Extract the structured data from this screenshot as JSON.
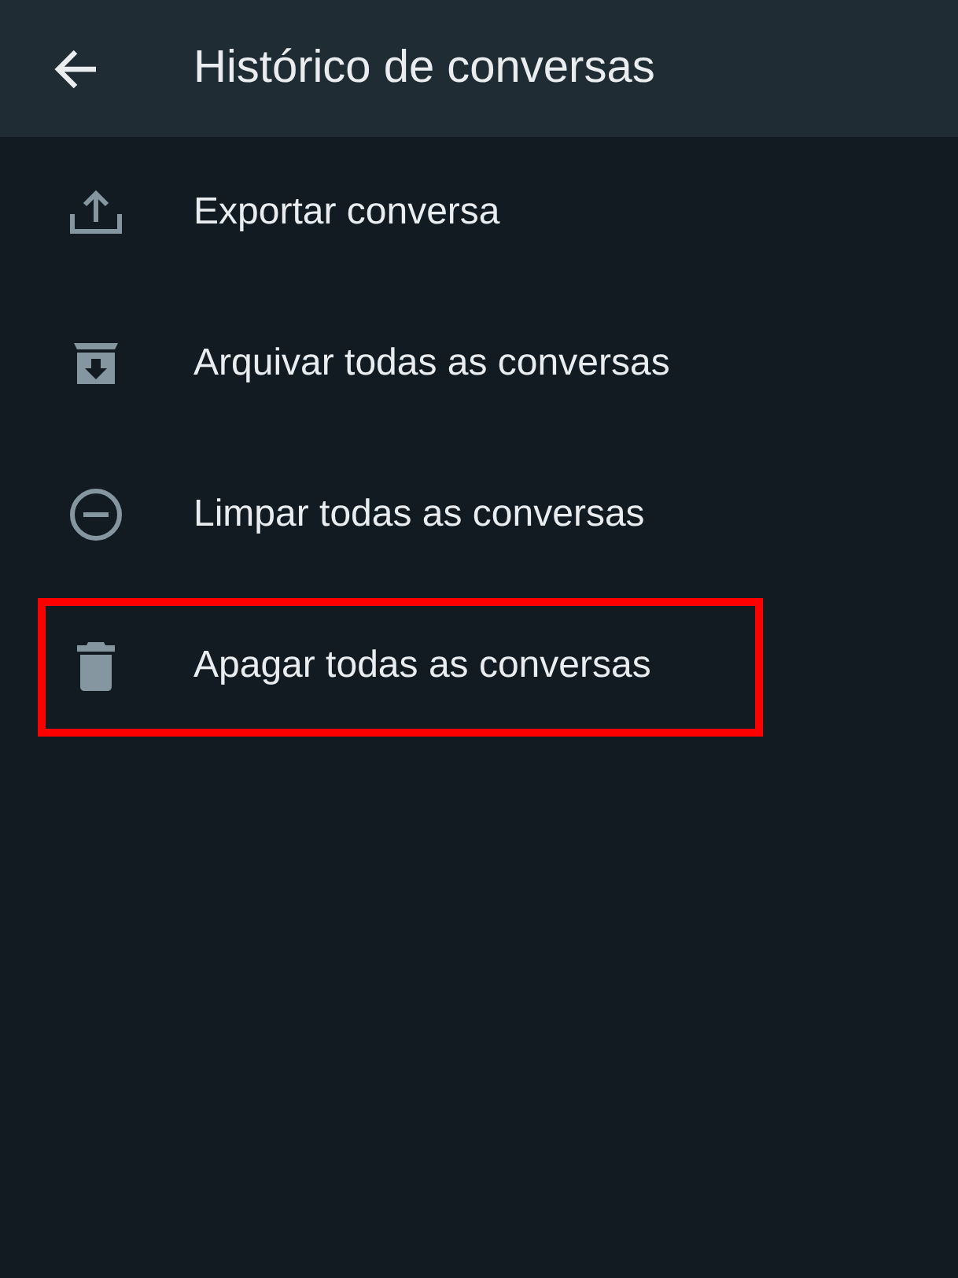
{
  "header": {
    "title": "Histórico de conversas"
  },
  "items": [
    {
      "kind": "export",
      "label": "Exportar conversa",
      "highlighted": false
    },
    {
      "kind": "archive",
      "label": "Arquivar todas as conversas",
      "highlighted": false
    },
    {
      "kind": "clear",
      "label": "Limpar todas as conversas",
      "highlighted": false
    },
    {
      "kind": "delete",
      "label": "Apagar todas as conversas",
      "highlighted": true
    }
  ]
}
